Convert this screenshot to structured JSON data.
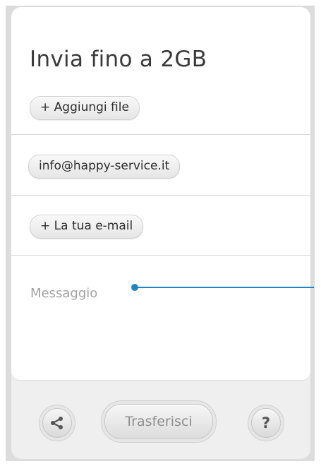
{
  "header": {
    "title": "Invia fino a 2GB"
  },
  "upload": {
    "add_files_label": "+ Aggiungi file"
  },
  "recipient": {
    "email": "info@happy-service.it"
  },
  "sender": {
    "email_label": "+ La tua e-mail"
  },
  "message": {
    "placeholder": "Messaggio"
  },
  "footer": {
    "transfer_label": "Trasferisci",
    "help_label": "?",
    "share_icon": "share-icon"
  },
  "colors": {
    "accent": "#1a86c8",
    "background": "#efefef",
    "card": "#ffffff"
  }
}
